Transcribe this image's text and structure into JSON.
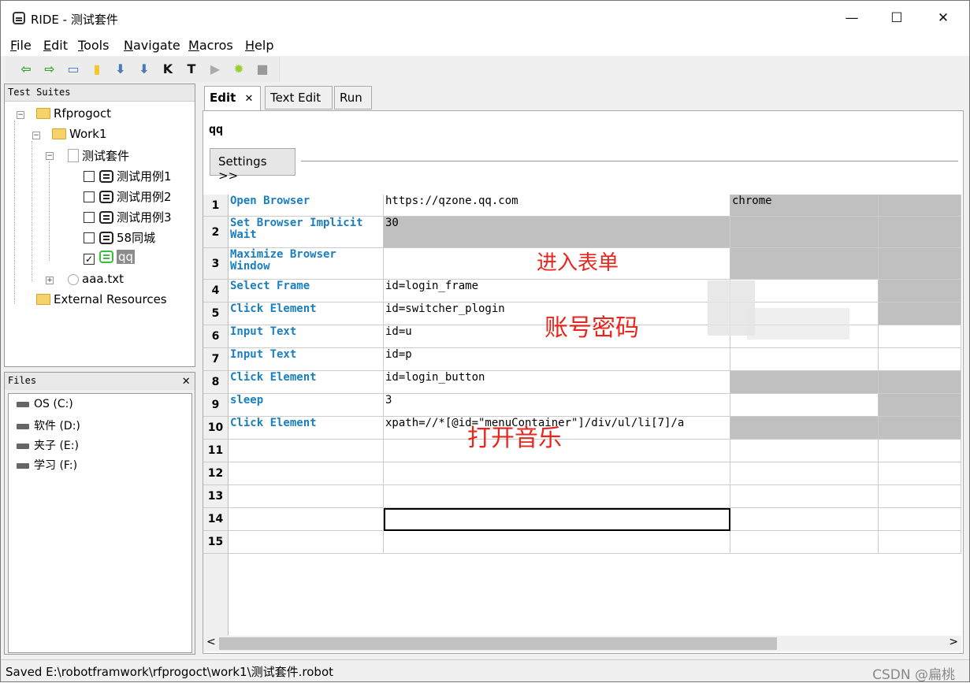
{
  "window": {
    "title": "RIDE - 测试套件",
    "minimize": "—",
    "maximize": "☐",
    "close": "✕"
  },
  "menu": [
    {
      "key": "F",
      "rest": "ile"
    },
    {
      "key": "E",
      "rest": "dit"
    },
    {
      "key": "T",
      "rest": "ools"
    },
    {
      "key": "N",
      "rest": "avigate"
    },
    {
      "key": "M",
      "rest": "acros"
    },
    {
      "key": "H",
      "rest": "elp"
    }
  ],
  "toolbar": {
    "icons": [
      "back-arrow-icon",
      "forward-arrow-icon",
      "open-folder-icon",
      "new-file-icon",
      "save-icon",
      "save-all-icon",
      "keyword-icon",
      "test-icon",
      "run-icon",
      "settings-gear-icon",
      "stop-icon"
    ],
    "glyphs": [
      "⇦",
      "⇨",
      "▭",
      "▮",
      "⬇",
      "⬇",
      "K",
      "T",
      "▶",
      "✹",
      "■"
    ],
    "colors": [
      "#3aa635",
      "#3aa635",
      "#4a7ab8",
      "#f2c830",
      "#4a7ab8",
      "#4a7ab8",
      "#111111",
      "#111111",
      "#aaaaaa",
      "#9acd32",
      "#999999"
    ]
  },
  "test_suites": {
    "header": "Test Suites",
    "root": "Rfprogoct",
    "folder": "Work1",
    "suite": "测试套件",
    "cases": [
      {
        "label": "测试用例1",
        "checked": false
      },
      {
        "label": "测试用例2",
        "checked": false
      },
      {
        "label": "测试用例3",
        "checked": false
      },
      {
        "label": "58同城",
        "checked": false
      },
      {
        "label": "qq",
        "checked": true
      }
    ],
    "resource_file": "aaa.txt",
    "external": "External Resources"
  },
  "files": {
    "header": "Files",
    "close": "✕",
    "drives": [
      "OS (C:)",
      "软件 (D:)",
      "夹子 (E:)",
      "学习 (F:)"
    ]
  },
  "tabs": [
    {
      "label": "Edit",
      "active": true,
      "close": "✕"
    },
    {
      "label": "Text Edit",
      "active": false
    },
    {
      "label": "Run",
      "active": false
    }
  ],
  "editor": {
    "suite_name": "qq",
    "settings_button": "Settings >>",
    "rows": [
      {
        "n": "1",
        "kw": "Open Browser",
        "a1": "https://qzone.qq.com",
        "a2": "chrome"
      },
      {
        "n": "2",
        "kw": "Set Browser Implicit Wait",
        "a1": "30",
        "a2": ""
      },
      {
        "n": "3",
        "kw": "Maximize Browser Window",
        "a1": "",
        "a2": ""
      },
      {
        "n": "4",
        "kw": "Select Frame",
        "a1": "id=login_frame",
        "a2": ""
      },
      {
        "n": "5",
        "kw": "Click Element",
        "a1": "id=switcher_plogin",
        "a2": ""
      },
      {
        "n": "6",
        "kw": "Input Text",
        "a1": "id=u",
        "a2": ""
      },
      {
        "n": "7",
        "kw": "Input Text",
        "a1": "id=p",
        "a2": ""
      },
      {
        "n": "8",
        "kw": "Click Element",
        "a1": "id=login_button",
        "a2": ""
      },
      {
        "n": "9",
        "kw": "sleep",
        "a1": "3",
        "a2": ""
      },
      {
        "n": "10",
        "kw": "Click Element",
        "a1": "xpath=//*[@id=\"menuContainer\"]/div/ul/li[7]/a",
        "a2": ""
      },
      {
        "n": "11",
        "kw": "",
        "a1": "",
        "a2": ""
      },
      {
        "n": "12",
        "kw": "",
        "a1": "",
        "a2": ""
      },
      {
        "n": "13",
        "kw": "",
        "a1": "",
        "a2": ""
      },
      {
        "n": "14",
        "kw": "",
        "a1": "",
        "a2": ""
      },
      {
        "n": "15",
        "kw": "",
        "a1": "",
        "a2": ""
      }
    ],
    "annotations": [
      "进入表单",
      "账号密码",
      "打开音乐"
    ],
    "scroll_left": "<",
    "scroll_right": ">"
  },
  "status": {
    "text": "Saved E:\\robotframwork\\rfprogoct\\work1\\测试套件.robot",
    "watermark": "CSDN @扁桃"
  }
}
